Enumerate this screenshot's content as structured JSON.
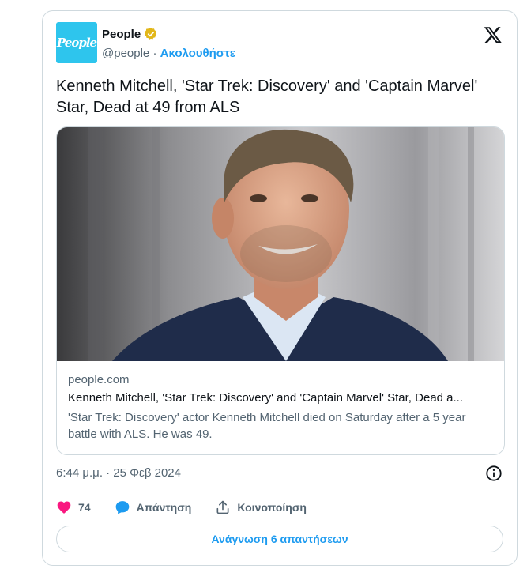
{
  "author": {
    "name": "People",
    "handle": "@people",
    "separator": "·",
    "follow_label": "Ακολουθήστε",
    "avatar_text": "People"
  },
  "tweet": {
    "text": "Kenneth Mitchell, 'Star Trek: Discovery' and 'Captain Marvel' Star, Dead at 49 from ALS",
    "timestamp": "6:44 μ.μ. · 25 Φεβ 2024"
  },
  "link_preview": {
    "domain": "people.com",
    "title": "Kenneth Mitchell, 'Star Trek: Discovery' and 'Captain Marvel' Star, Dead a...",
    "description": "'Star Trek: Discovery' actor Kenneth Mitchell died on Saturday after a 5 year battle with ALS. He was 49."
  },
  "actions": {
    "like_count": "74",
    "reply_label": "Απάντηση",
    "share_label": "Κοινοποίηση"
  },
  "replies_button_label": "Ανάγνωση 6 απαντήσεων",
  "colors": {
    "accent": "#1d9bf0",
    "like": "#f91880",
    "verified": "#e2b719",
    "avatar_bg": "#2ec5ed"
  }
}
